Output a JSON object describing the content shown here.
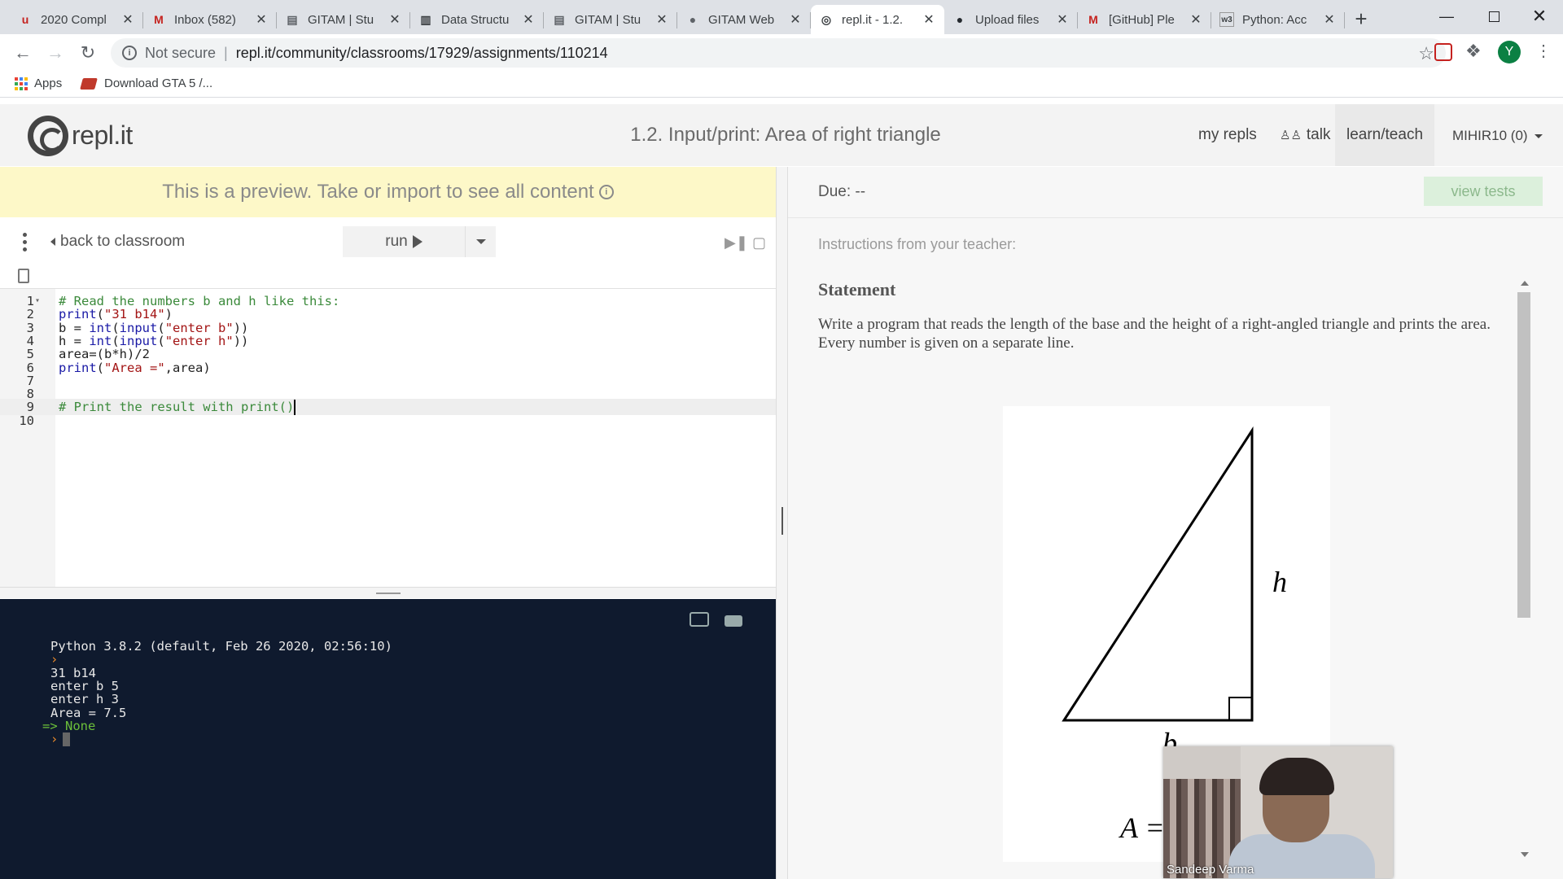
{
  "browser": {
    "tabs": [
      {
        "title": "2020 Compl",
        "icon": "u-icon",
        "icon_color": "#c5221f"
      },
      {
        "title": "Inbox (582)",
        "icon": "gmail-icon",
        "icon_color": "#c5221f"
      },
      {
        "title": "GITAM | Stu",
        "icon": "doc-icon",
        "icon_color": "#5f6368"
      },
      {
        "title": "Data Structu",
        "icon": "book-icon",
        "icon_color": "#3c4043"
      },
      {
        "title": "GITAM | Stu",
        "icon": "doc-icon",
        "icon_color": "#5f6368"
      },
      {
        "title": "GITAM Web",
        "icon": "globe-icon",
        "icon_color": "#5f6368"
      },
      {
        "title": "repl.it - 1.2.",
        "icon": "replit-icon",
        "icon_color": "#3c4043"
      },
      {
        "title": "Upload files",
        "icon": "github-icon",
        "icon_color": "#24292e"
      },
      {
        "title": "[GitHub] Ple",
        "icon": "gmail-icon",
        "icon_color": "#c5221f"
      },
      {
        "title": "Python: Acc",
        "icon": "w3schools-icon",
        "icon_color": "#3c4043"
      }
    ],
    "address": {
      "not_secure": "Not secure",
      "url": "repl.it/community/classrooms/17929/assignments/110214"
    },
    "profile_initial": "Y",
    "bookmarks": [
      {
        "label": "Apps",
        "icon": "apps-grid-icon"
      },
      {
        "label": "Download GTA 5 /...",
        "icon": "gta-icon"
      }
    ]
  },
  "header": {
    "logo": "repl.it",
    "title": "1.2. Input/print: Area of right triangle",
    "nav": {
      "my_repls": "my repls",
      "talk": "talk",
      "learn_teach": "learn/teach",
      "user": "MIHIR10 (0)"
    }
  },
  "preview_banner": "This is a preview. Take or import to see all content",
  "controls": {
    "back": "back to classroom",
    "run": "run"
  },
  "editor": {
    "active_line": 9,
    "lines": [
      {
        "n": "1",
        "tokens": [
          {
            "t": "# Read the numbers b and h like this:",
            "c": "tok-com"
          }
        ]
      },
      {
        "n": "2",
        "tokens": [
          {
            "t": "print",
            "c": "tok-fn"
          },
          {
            "t": "(",
            "c": "tok-plain"
          },
          {
            "t": "\"31 b14\"",
            "c": "tok-str"
          },
          {
            "t": ")",
            "c": "tok-plain"
          }
        ]
      },
      {
        "n": "3",
        "tokens": [
          {
            "t": "b = ",
            "c": "tok-plain"
          },
          {
            "t": "int",
            "c": "tok-fn"
          },
          {
            "t": "(",
            "c": "tok-plain"
          },
          {
            "t": "input",
            "c": "tok-fn"
          },
          {
            "t": "(",
            "c": "tok-plain"
          },
          {
            "t": "\"enter b\"",
            "c": "tok-str"
          },
          {
            "t": "))",
            "c": "tok-plain"
          }
        ]
      },
      {
        "n": "4",
        "tokens": [
          {
            "t": "h = ",
            "c": "tok-plain"
          },
          {
            "t": "int",
            "c": "tok-fn"
          },
          {
            "t": "(",
            "c": "tok-plain"
          },
          {
            "t": "input",
            "c": "tok-fn"
          },
          {
            "t": "(",
            "c": "tok-plain"
          },
          {
            "t": "\"enter h\"",
            "c": "tok-str"
          },
          {
            "t": "))",
            "c": "tok-plain"
          }
        ]
      },
      {
        "n": "5",
        "tokens": [
          {
            "t": "area=(b*h)/2",
            "c": "tok-plain"
          }
        ]
      },
      {
        "n": "6",
        "tokens": [
          {
            "t": "print",
            "c": "tok-fn"
          },
          {
            "t": "(",
            "c": "tok-plain"
          },
          {
            "t": "\"Area =\"",
            "c": "tok-str"
          },
          {
            "t": ",area)",
            "c": "tok-plain"
          }
        ]
      },
      {
        "n": "7",
        "tokens": []
      },
      {
        "n": "8",
        "tokens": []
      },
      {
        "n": "9",
        "tokens": [
          {
            "t": "# Print the result with print()",
            "c": "tok-com"
          }
        ]
      },
      {
        "n": "10",
        "tokens": []
      }
    ]
  },
  "console": {
    "lines": [
      {
        "t": "Python 3.8.2 (default, Feb 26 2020, 02:56:10)",
        "c": ""
      },
      {
        "t": "›",
        "c": "t-prompt"
      },
      {
        "t": "31 b14",
        "c": ""
      },
      {
        "t": "enter b 5",
        "c": ""
      },
      {
        "t": "enter h 3",
        "c": ""
      },
      {
        "t": "Area = 7.5",
        "c": ""
      },
      {
        "t": "=> None",
        "c": "t-green"
      },
      {
        "t": "›",
        "c": "t-prompt"
      }
    ]
  },
  "assignment": {
    "due": "Due: --",
    "view_tests": "view tests",
    "instructions_label": "Instructions from your teacher:",
    "statement_title": "Statement",
    "statement_body": "Write a program that reads the length of the base and the height of a right-angled triangle and prints the area. Every number is given on a separate line.",
    "figure_labels": {
      "h": "h",
      "b": "b",
      "a": "A ="
    }
  },
  "webcam": {
    "name": "Sandeep Varma"
  }
}
